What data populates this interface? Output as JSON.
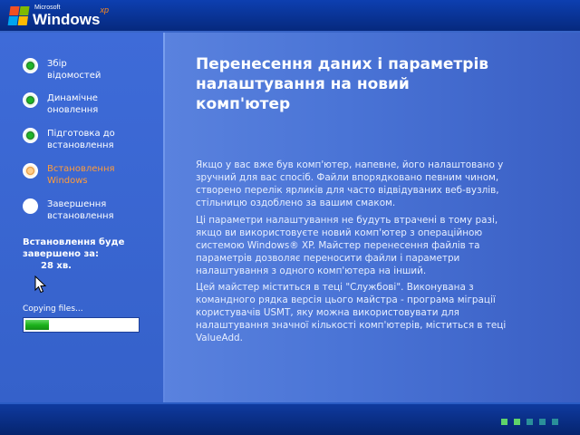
{
  "brand": {
    "microsoft": "Microsoft",
    "windows": "Windows",
    "xp": "xp"
  },
  "steps": [
    {
      "line1": "Збір",
      "line2": "відомостей",
      "state": "done"
    },
    {
      "line1": "Динамічне",
      "line2": "оновлення",
      "state": "done"
    },
    {
      "line1": "Підготовка до",
      "line2": "встановлення",
      "state": "done"
    },
    {
      "line1": "Встановлення",
      "line2": "Windows",
      "state": "current"
    },
    {
      "line1": "Завершення",
      "line2": "встановлення",
      "state": "pending"
    }
  ],
  "eta": {
    "line1": "Встановлення буде",
    "line2": "завершено за:",
    "value": "28 хв."
  },
  "progress": {
    "label": "Copying files...",
    "fraction": 0.21
  },
  "content": {
    "title_lines": [
      "Перенесення даних і параметрів",
      "налаштування на новий",
      "комп'ютер"
    ],
    "paragraph1": "Якщо у вас вже був комп'ютер, напевне, його налаштовано у зручний для вас спосіб. Файли впорядковано певним чином, створено перелік ярликів для часто відвідуваних веб-вузлів, стільницю оздоблено за вашим смаком.",
    "paragraph2": "Ці параметри налаштування не будуть втрачені в тому разі, якщо ви використовуєте новий комп'ютер з операційною системою Windows® XP. Майстер перенесення файлів та параметрів дозволяє переносити файли і параметри налаштування з одного комп'ютера на інший.",
    "paragraph3": "Цей майстер міститься в теці \"Службові\". Виконувана з командного рядка версія цього майстра - програма міграції користувачів USMT, яку можна використовувати для налаштування значної кількості комп'ютерів, міститься в теці ValueAdd."
  },
  "colors": {
    "current_step": "#ff9c3a",
    "progress_green": "#1db31d",
    "background_blue": "#5a7edc"
  }
}
